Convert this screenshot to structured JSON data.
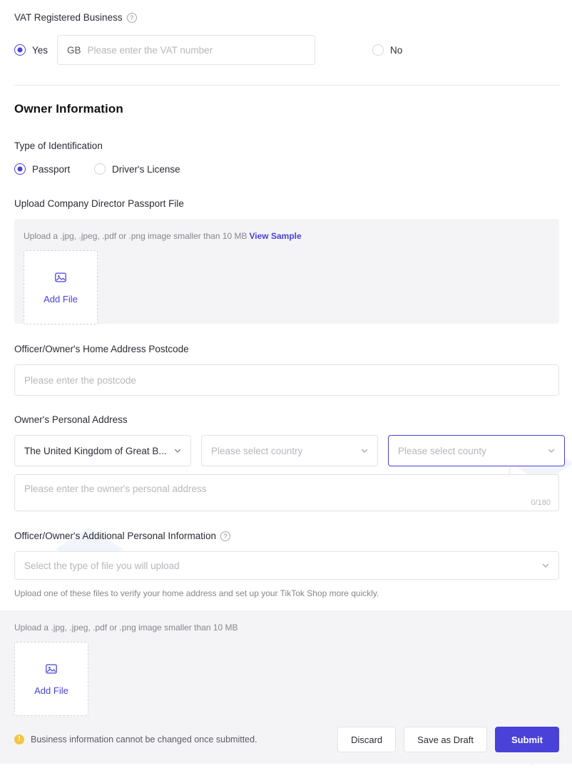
{
  "vat_section": {
    "label": "VAT Registered Business",
    "help_icon": "question-circle-icon",
    "options": [
      {
        "label": "Yes",
        "selected": true
      },
      {
        "label": "No",
        "selected": false
      }
    ],
    "vat_input": {
      "prefix": "GB",
      "value": "",
      "placeholder": "Please enter the VAT number"
    }
  },
  "owner_section": {
    "title": "Owner Information",
    "identification": {
      "label": "Type of Identification",
      "options": [
        {
          "label": "Passport",
          "selected": true
        },
        {
          "label": "Driver's License",
          "selected": false
        }
      ]
    },
    "passport_upload": {
      "label": "Upload Company Director Passport File",
      "hint": "Upload a .jpg, .jpeg, .pdf or .png image smaller than 10 MB",
      "view_sample_label": "View Sample",
      "add_file_label": "Add File",
      "add_file_icon": "image-placeholder-icon"
    },
    "postcode": {
      "label": "Officer/Owner's Home Address Postcode",
      "value": "",
      "placeholder": "Please enter the postcode"
    },
    "personal_address": {
      "label": "Owner's Personal Address",
      "region_select": {
        "value": "The United Kingdom of Great B...",
        "placeholder": "",
        "focused": false
      },
      "country_select": {
        "value": "",
        "placeholder": "Please select country",
        "focused": false
      },
      "county_select": {
        "value": "",
        "placeholder": "Please select county",
        "focused": true
      },
      "address_textarea": {
        "value": "",
        "placeholder": "Please enter the owner's personal address",
        "counter": "0/180"
      }
    },
    "additional_info": {
      "label": "Officer/Owner's Additional Personal Information",
      "help_icon": "question-circle-icon",
      "file_type_select": {
        "value": "",
        "placeholder": "Select the type of file you will upload"
      },
      "note": "Upload one of these files to verify your home address and set up your TikTok Shop more quickly.",
      "upload": {
        "hint": "Upload a .jpg, .jpeg, .pdf or .png image smaller than 10 MB",
        "add_file_label": "Add File",
        "add_file_icon": "image-placeholder-icon"
      }
    }
  },
  "footer": {
    "warning_icon": "warning-circle-icon",
    "warning_text": "Business information cannot be changed once submitted.",
    "discard_label": "Discard",
    "save_draft_label": "Save as Draft",
    "submit_label": "Submit"
  },
  "colors": {
    "accent": "#4a41d8",
    "panel": "#f4f4f7",
    "border": "#e3e3e6",
    "placeholder": "#b6b7bd",
    "warning": "#f5c542"
  }
}
